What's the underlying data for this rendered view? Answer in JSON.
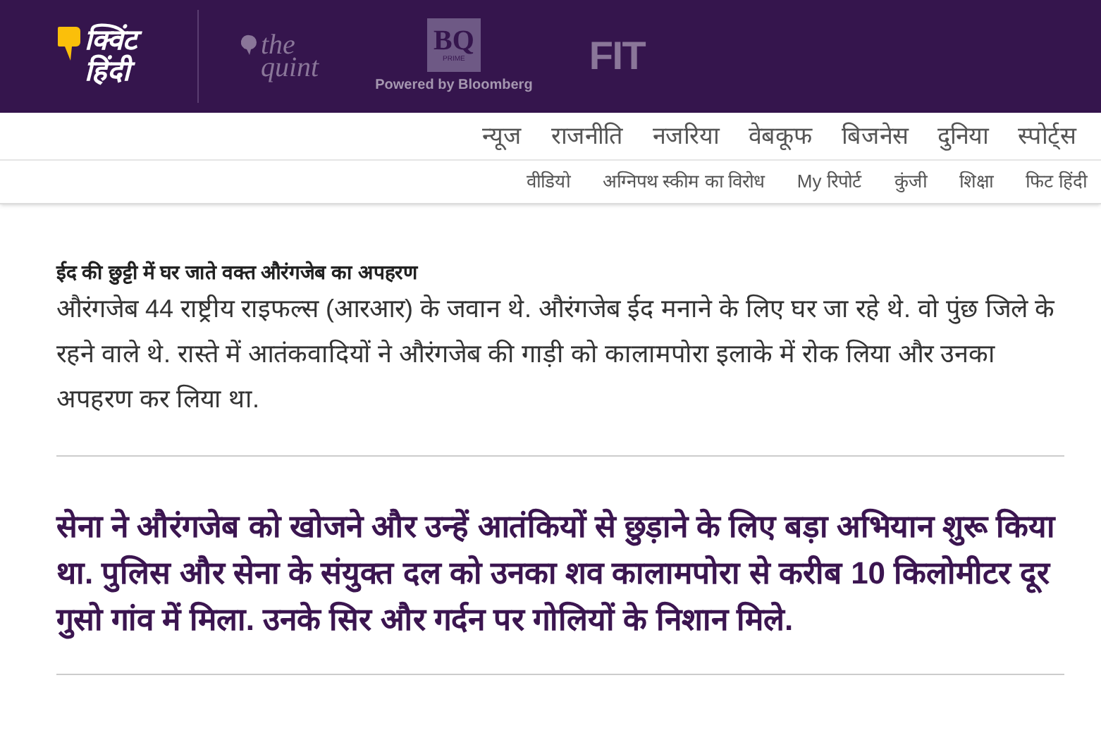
{
  "header": {
    "brand": {
      "line_1": "क्विंट",
      "line_2": "हिंदी"
    },
    "sister_sites": [
      {
        "kind": "quint",
        "line_1": "the",
        "line_2": "quint"
      },
      {
        "kind": "bq",
        "line_1": "BQ",
        "line_2": "PRIME",
        "tagline": "Powered by Bloomberg"
      },
      {
        "kind": "fit",
        "line_1": "FIT"
      }
    ]
  },
  "primary_nav": [
    "न्यूज",
    "राजनीति",
    "नजरिया",
    "वेबकूफ",
    "बिजनेस",
    "दुनिया",
    "स्पोर्ट्स"
  ],
  "secondary_nav": [
    "वीडियो",
    "अग्निपथ स्कीम का विरोध",
    "My रिपोर्ट",
    "कुंजी",
    "शिक्षा",
    "फिट हिंदी"
  ],
  "article": {
    "subheading": "ईद की छुट्टी में घर जाते वक्त औरंगजेब का अपहरण",
    "paragraph": "औरंगजेब 44 राष्ट्रीय राइफल्स (आरआर) के जवान थे. औरंगजेब ईद मनाने के लिए घर जा रहे थे. वो पुंछ जिले के रहने वाले थे. रास्ते में आतंकवादियों ने औरंगजेब की गाड़ी को कालामपोरा इलाके में रोक लिया और उनका अपहरण कर लिया था.",
    "highlight": "सेना ने औरंगजेब को खोजने और उन्हें आतंकियों से छुड़ाने के लिए बड़ा अभियान शुरू किया था. पुलिस और सेना के संयुक्त दल को उनका शव कालामपोरा से करीब 10 किलोमीटर दूर गुसो गांव में मिला. उनके सिर और गर्दन पर गोलियों के निशान मिले."
  }
}
